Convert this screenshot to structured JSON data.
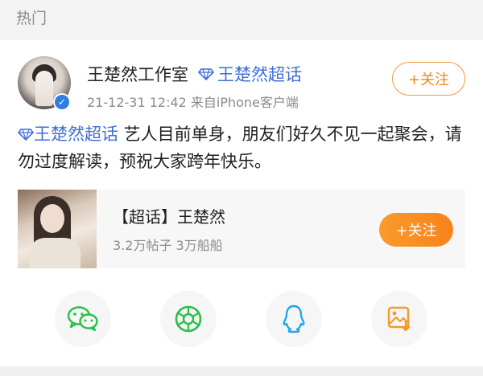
{
  "section": {
    "title": "热门"
  },
  "post": {
    "author": "王楚然工作室",
    "topic_tag": "王楚然超话",
    "meta": "21-12-31 12:42  来自iPhone客户端",
    "follow_label": "+关注",
    "text_topic": "王楚然超话",
    "text_body": " 艺人目前单身，朋友们好久不见一起聚会，请勿过度解读，预祝大家跨年快乐。"
  },
  "super_topic_card": {
    "title": "【超话】王楚然",
    "subtitle": "3.2万帖子 3万船船",
    "follow_label": "+关注"
  },
  "share": {
    "buttons": [
      "wechat-icon",
      "moments-icon",
      "qq-icon",
      "save-image-icon"
    ]
  },
  "colors": {
    "link": "#3f6fd6",
    "accent": "#f7831a",
    "wechat": "#27c048",
    "qq": "#1da7f2",
    "save": "#f59a26"
  }
}
